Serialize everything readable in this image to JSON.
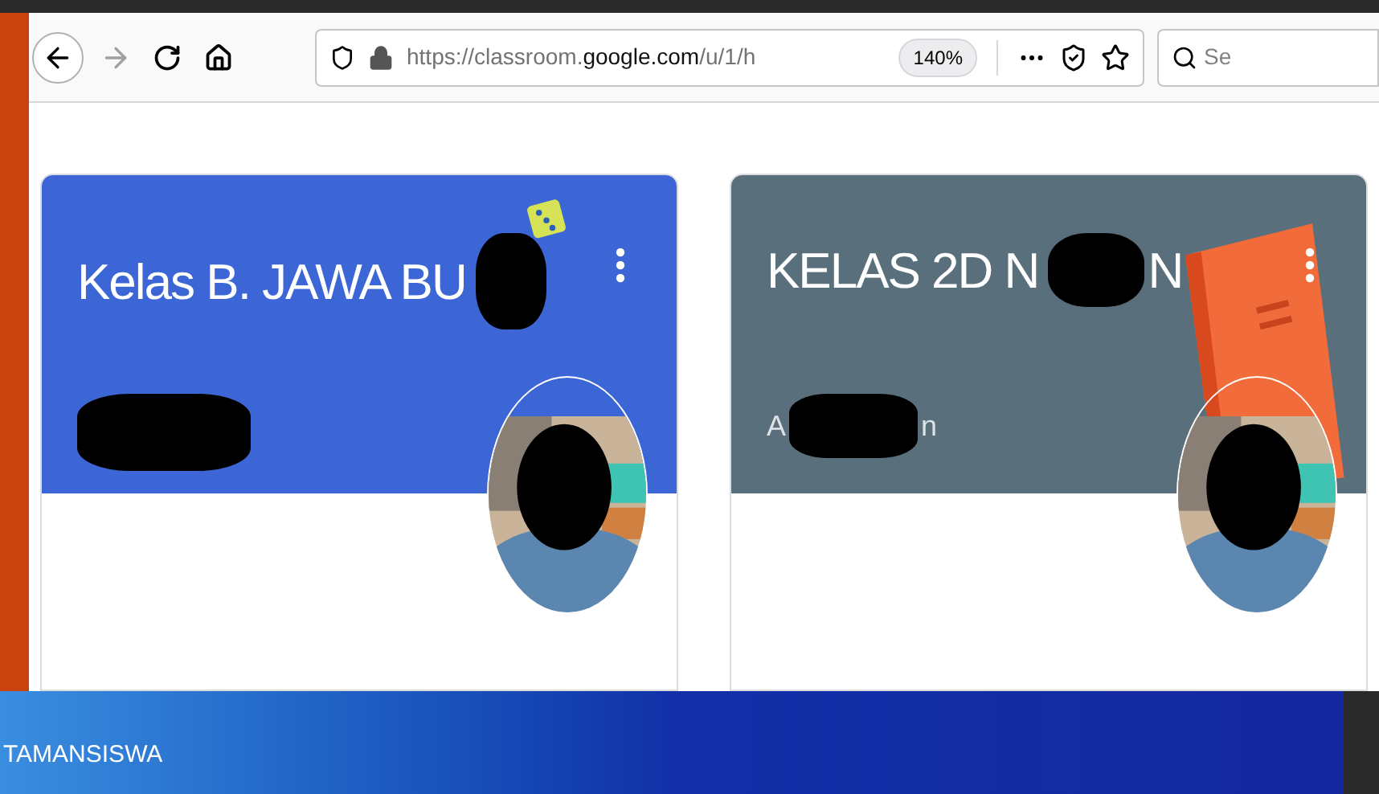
{
  "browser": {
    "url": "https://classroom.**google.com**/u/1/h",
    "zoom": "140%",
    "search": {
      "placeholder": "Se"
    }
  },
  "classes": [
    {
      "title": "Kelas B. JAWA BU",
      "color": "#3c66d6",
      "kind": "dice"
    },
    {
      "title": "KELAS 2D N",
      "title_tail": "N",
      "subtitle_start": "A",
      "subtitle_end": "n",
      "color": "#5a6f7c",
      "kind": "book"
    }
  ],
  "banner": {
    "text": "TAMANSISWA"
  }
}
